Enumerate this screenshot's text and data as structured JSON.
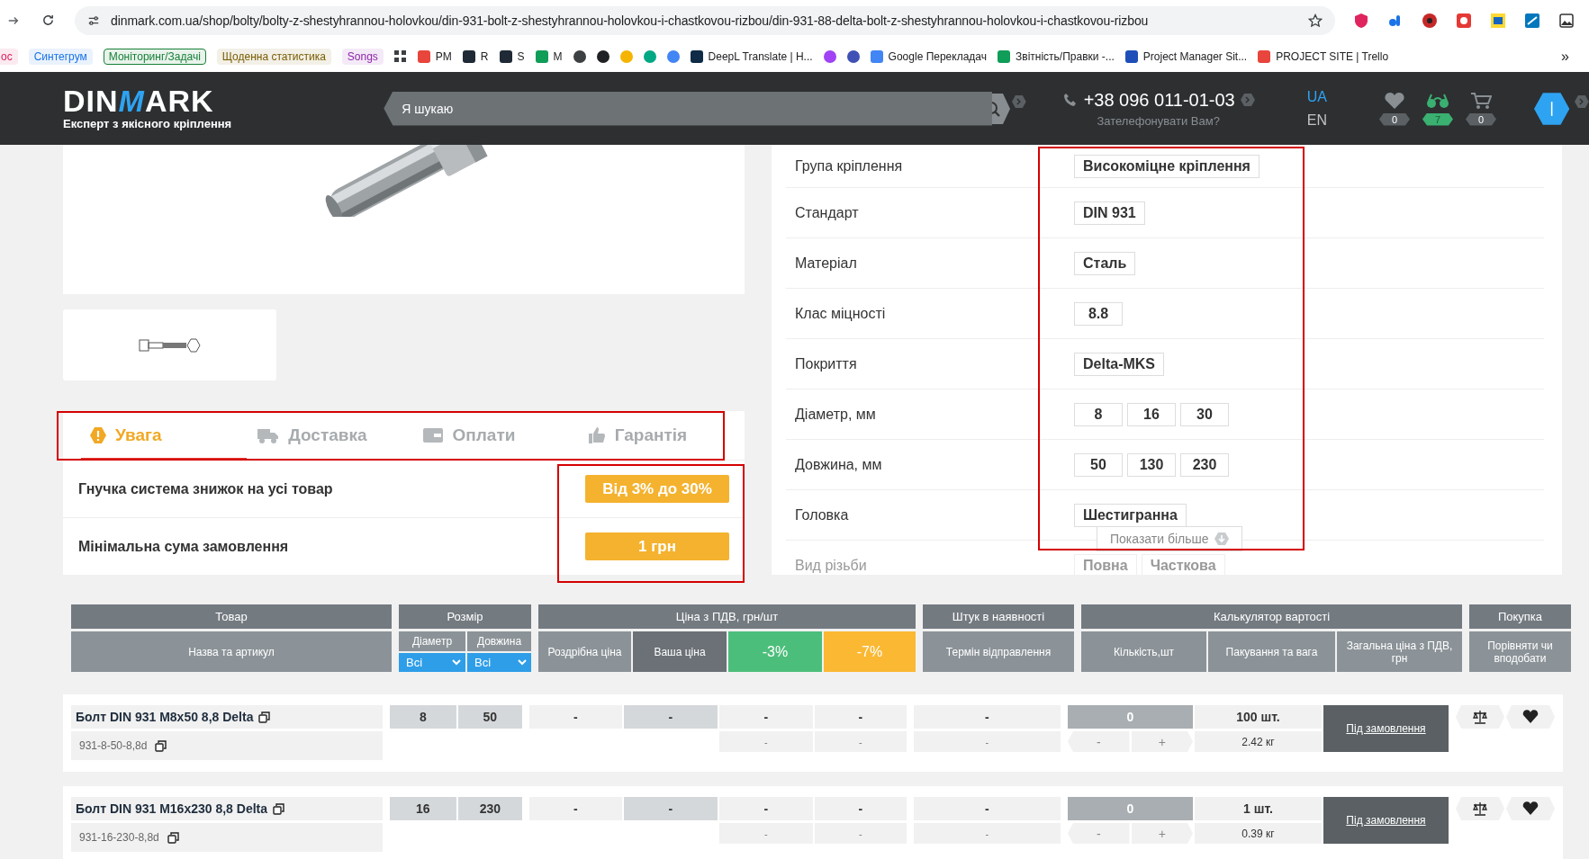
{
  "browser": {
    "url": "dinmark.com.ua/shop/bolty/bolty-z-shestyhrannou-holovkou/din-931-bolt-z-shestyhrannou-holovkou-i-chastkovou-rizbou/din-931-88-delta-bolt-z-shestyhrannou-holovkou-i-chastkovou-rizbou",
    "bookmarks": [
      {
        "kind": "chip",
        "label": "ос",
        "color": "#d81b60"
      },
      {
        "kind": "chip",
        "label": "Синтегрум",
        "color": "#1a73e8"
      },
      {
        "kind": "chip",
        "label": "Моніторинг/Задачі",
        "color": "#188038"
      },
      {
        "kind": "chip",
        "label": "Щоденна статистика",
        "color": "#7a5c00"
      },
      {
        "kind": "chip",
        "label": "Songs",
        "color": "#8e24aa"
      },
      {
        "kind": "apps"
      },
      {
        "kind": "link",
        "label": "PM",
        "color": "#e8453c"
      },
      {
        "kind": "link",
        "label": "R",
        "color": "#1f2a36"
      },
      {
        "kind": "link",
        "label": "S",
        "color": "#1f2a36"
      },
      {
        "kind": "link",
        "label": "M",
        "color": "#0f9d58"
      },
      {
        "kind": "icon",
        "color": "#3c4043"
      },
      {
        "kind": "icon",
        "color": "#202124"
      },
      {
        "kind": "icon",
        "color": "#f4b400"
      },
      {
        "kind": "icon",
        "color": "#00a884"
      },
      {
        "kind": "icon",
        "color": "#4285f4"
      },
      {
        "kind": "link",
        "label": "DeepL Translate | H...",
        "color": "#0f2b46"
      },
      {
        "kind": "icon",
        "color": "#a142f4"
      },
      {
        "kind": "icon",
        "color": "#3f51b5"
      },
      {
        "kind": "link",
        "label": "Google Перекладач",
        "color": "#4285f4"
      },
      {
        "kind": "link",
        "label": "Звітність/Правки -...",
        "color": "#0f9d58"
      },
      {
        "kind": "link",
        "label": "Project Manager Sit...",
        "color": "#1e4fb8"
      },
      {
        "kind": "link",
        "label": "PROJECT SITE | Trello",
        "color": "#e8453c"
      },
      {
        "kind": "more",
        "label": "»"
      }
    ]
  },
  "header": {
    "logo": {
      "start": "DIN",
      "mark": "M",
      "end": "ARK",
      "tagline": "Експерт з якісного кріплення"
    },
    "search": {
      "placeholder": "Я шукаю"
    },
    "phone": "+38 096 011-01-03",
    "callback": "Зателефонувати Вам?",
    "languages": [
      {
        "label": "UA",
        "selected": true
      },
      {
        "label": "EN",
        "selected": false
      }
    ],
    "counters": [
      {
        "kind": "favorites",
        "count": "0",
        "active": false
      },
      {
        "kind": "compare",
        "count": "7",
        "active": true
      },
      {
        "kind": "cart",
        "count": "0",
        "active": false
      }
    ]
  },
  "tabs": [
    {
      "kind": "warning",
      "label": "Увага",
      "selected": true
    },
    {
      "kind": "delivery",
      "label": "Доставка",
      "selected": false
    },
    {
      "kind": "payment",
      "label": "Оплати",
      "selected": false
    },
    {
      "kind": "guarantee",
      "label": "Гарантія",
      "selected": false
    }
  ],
  "info": [
    {
      "label": "Гнучка система знижок на усі товар",
      "value": "Від 3% до 30%"
    },
    {
      "label": "Мінімальна сума замовлення",
      "value": "1 грн"
    }
  ],
  "specs": [
    {
      "label": "Група кріплення",
      "values": [
        "Високоміцне кріплення"
      ],
      "faded": false
    },
    {
      "label": "Стандарт",
      "values": [
        "DIN 931"
      ],
      "faded": false
    },
    {
      "label": "Матеріал",
      "values": [
        "Сталь"
      ],
      "faded": false
    },
    {
      "label": "Клас міцності",
      "values": [
        "8.8"
      ],
      "faded": false
    },
    {
      "label": "Покриття",
      "values": [
        "Delta-MKS"
      ],
      "faded": false
    },
    {
      "label": "Діаметр, мм",
      "values": [
        "8",
        "16",
        "30"
      ],
      "faded": false
    },
    {
      "label": "Довжина, мм",
      "values": [
        "50",
        "130",
        "230"
      ],
      "faded": false
    },
    {
      "label": "Головка",
      "values": [
        "Шестигранна"
      ],
      "faded": false
    },
    {
      "label": "Вид різьби",
      "values": [
        "Повна",
        "Часткова"
      ],
      "faded": true
    }
  ],
  "show_more": "Показати більше",
  "table": {
    "groups": [
      {
        "label": "Товар",
        "columns": [
          {
            "kind": "plain",
            "label": "Назва та артикул"
          }
        ]
      },
      {
        "label": "Розмір",
        "columns": [
          {
            "kind": "filter",
            "label": "Діаметр",
            "value": "Всі"
          },
          {
            "kind": "filter",
            "label": "Довжина",
            "value": "Всі"
          }
        ]
      },
      {
        "label": "Ціна з ПДВ, грн/шт",
        "columns": [
          {
            "kind": "plain",
            "label": "Роздрібна ціна"
          },
          {
            "kind": "dark",
            "label": "Ваша ціна"
          },
          {
            "kind": "discount",
            "label": "-3%",
            "color": "#4cbe7b"
          },
          {
            "kind": "discount",
            "label": "-7%",
            "color": "#fbb832"
          }
        ]
      },
      {
        "label": "Штук в наявності",
        "columns": [
          {
            "kind": "plain",
            "label": "Термін відправлення"
          }
        ]
      },
      {
        "label": "Калькулятор вартості",
        "columns": [
          {
            "kind": "plain",
            "label": "Кількість,шт"
          },
          {
            "kind": "plain",
            "label": "Пакування та вага"
          },
          {
            "kind": "plain",
            "label": "Загальна ціна з ПДВ, грн"
          }
        ]
      },
      {
        "label": "Покупка",
        "columns": [
          {
            "kind": "plain",
            "label": "Порівняти чи вподобати"
          }
        ]
      }
    ],
    "rows": [
      {
        "name": "Болт DIN 931 M8x50 8,8 Delta",
        "sku": "931-8-50-8,8d",
        "diameter": "8",
        "length": "50",
        "retail": "-",
        "yours": "-",
        "minus3": "-",
        "minus3_extra": "-",
        "minus7": "-",
        "minus7_extra": "-",
        "stock": "-",
        "ship": "-",
        "qty": "0",
        "minus": "-",
        "plus": "+",
        "pack": "100 шт.",
        "weight": "2.42 кг",
        "action": "Під замовлення"
      },
      {
        "name": "Болт DIN 931 M16x230 8,8 Delta",
        "sku": "931-16-230-8,8d",
        "diameter": "16",
        "length": "230",
        "retail": "-",
        "yours": "-",
        "minus3": "-",
        "minus3_extra": "-",
        "minus7": "-",
        "minus7_extra": "-",
        "stock": "-",
        "ship": "-",
        "qty": "0",
        "minus": "-",
        "plus": "+",
        "pack": "1 шт.",
        "weight": "0.39 кг",
        "action": "Під замовлення"
      }
    ]
  }
}
